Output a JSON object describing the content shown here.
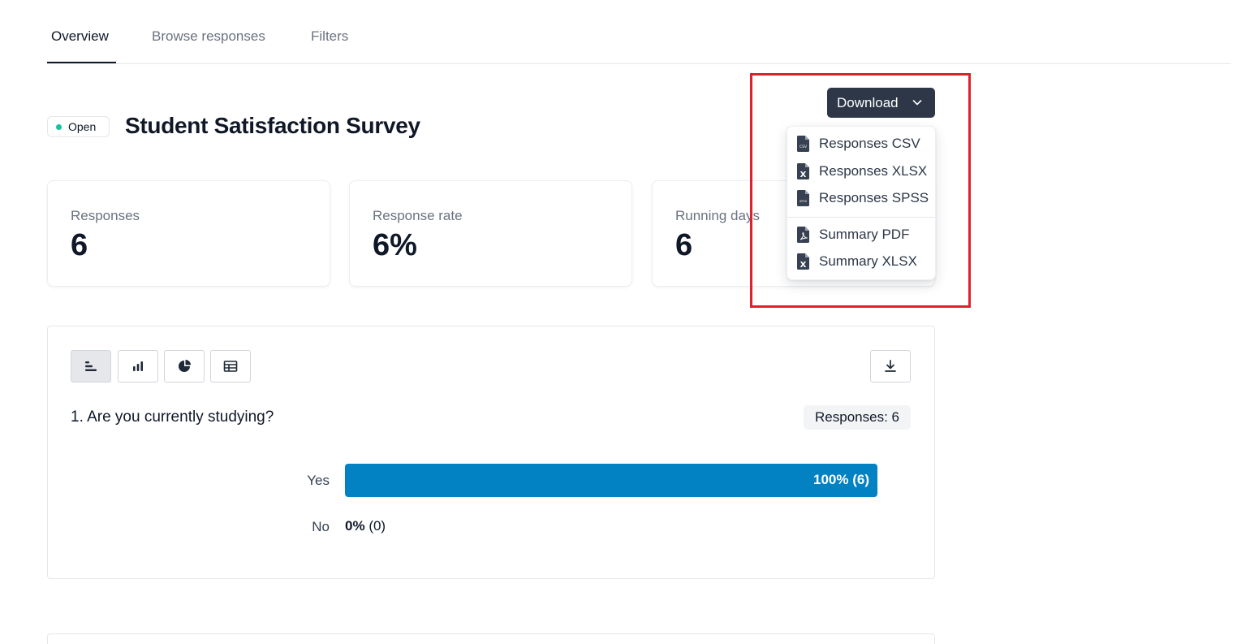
{
  "tabs": [
    {
      "label": "Overview",
      "active": true
    },
    {
      "label": "Browse responses",
      "active": false
    },
    {
      "label": "Filters",
      "active": false
    }
  ],
  "header": {
    "status": "Open",
    "status_color": "#10c4a0",
    "title": "Student Satisfaction Survey"
  },
  "download": {
    "label": "Download",
    "items": [
      {
        "label": "Responses CSV",
        "icon": "csv-file-icon",
        "tag": "CSV"
      },
      {
        "label": "Responses XLSX",
        "icon": "xlsx-file-icon",
        "tag": "X"
      },
      {
        "label": "Responses SPSS",
        "icon": "spss-file-icon",
        "tag": "SPSS"
      },
      {
        "label": "Summary PDF",
        "icon": "pdf-file-icon",
        "tag": "PDF"
      },
      {
        "label": "Summary XLSX",
        "icon": "xlsx-file-icon",
        "tag": "X"
      }
    ]
  },
  "stats": [
    {
      "label": "Responses",
      "value": "6"
    },
    {
      "label": "Response rate",
      "value": "6%"
    },
    {
      "label": "Running days",
      "value": "6"
    }
  ],
  "question": {
    "title": "1. Are you currently studying?",
    "responses_badge": "Responses: 6",
    "view_buttons": [
      {
        "icon": "horizontal-bar-chart-icon",
        "active": true
      },
      {
        "icon": "vertical-bar-chart-icon",
        "active": false
      },
      {
        "icon": "pie-chart-icon",
        "active": false
      },
      {
        "icon": "table-icon",
        "active": false
      }
    ],
    "download_icon": "download-icon",
    "answers": [
      {
        "label": "Yes",
        "percent": 100,
        "percent_label": "100%",
        "count_label": "(6)"
      },
      {
        "label": "No",
        "percent": 0,
        "percent_label": "0%",
        "count_label": "(0)"
      }
    ],
    "bar_color": "#0281c3"
  },
  "highlight_color": "#e0202e"
}
